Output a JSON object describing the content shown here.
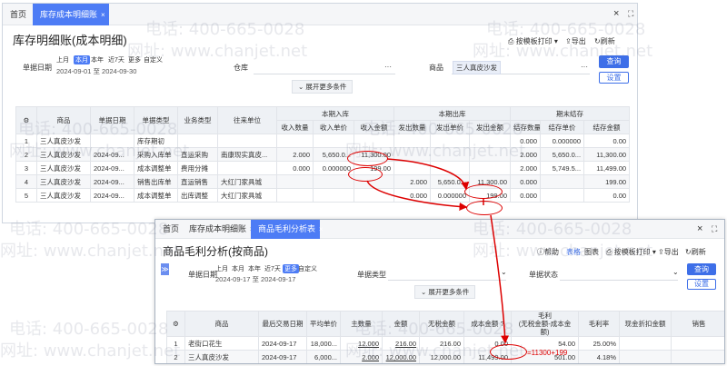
{
  "watermarks": {
    "phone": "电话: 400-665-0028",
    "site": "网址: www.chanjet.net"
  },
  "win1": {
    "tabs": [
      {
        "label": "首页"
      },
      {
        "label": "库存成本明细账",
        "close": "×"
      }
    ],
    "winbtns": {
      "close": "×",
      "max": "⛶"
    },
    "title": "库存明细账(成本明细)",
    "toolbar": {
      "print": "按模板打印",
      "export": "导出",
      "refresh": "刷新"
    },
    "filter": {
      "date_label": "单据日期",
      "chips": [
        "上月",
        "本月",
        "本年",
        "近7天",
        "更多",
        "自定义"
      ],
      "active_chip": "本月",
      "date_range": "2024-09-01 至 2024-09-30",
      "warehouse_label": "仓库",
      "warehouse_more": "···",
      "goods_label": "商品",
      "goods_value": "三人真皮沙发",
      "goods_more": "···",
      "query": "查询",
      "settings": "设置",
      "expand": "展开更多条件"
    },
    "table": {
      "headers_top": [
        "商品",
        "单据日期",
        "单据类型",
        "业务类型",
        "往来单位",
        "本期入库",
        "本期出库",
        "期末结存"
      ],
      "headers_sub": [
        "收入数量",
        "收入单价",
        "收入金额",
        "发出数量",
        "发出单价",
        "发出金额",
        "结存数量",
        "结存单价",
        "结存金额"
      ],
      "rows": [
        [
          "1",
          "三人真皮沙发",
          "",
          "库存期初",
          "",
          "",
          "",
          "",
          "",
          "",
          "",
          "",
          "0.000",
          "0.000000",
          "0.00"
        ],
        [
          "2",
          "三人真皮沙发",
          "2024-09...",
          "采购入库单",
          "直运采购",
          "南康现实真皮...",
          "2.000",
          "5,650.0...",
          "11,300.00",
          "",
          "",
          "",
          "2.000",
          "5,650.0...",
          "11,300.00"
        ],
        [
          "3",
          "三人真皮沙发",
          "2024-09...",
          "成本调整单",
          "费用分摊",
          "",
          "0.000",
          "0.000000",
          "199.00",
          "",
          "",
          "",
          "2.000",
          "5,749.5...",
          "11,499.00"
        ],
        [
          "4",
          "三人真皮沙发",
          "2024-09...",
          "销售出库单",
          "直运销售",
          "大红门家具城",
          "",
          "",
          "",
          "2.000",
          "5,650.0...",
          "11,300.00",
          "0.000",
          "",
          "199.00"
        ],
        [
          "5",
          "三人真皮沙发",
          "2024-09...",
          "成本调整单",
          "出库调整",
          "大红门家具城",
          "",
          "",
          "",
          "0.000",
          "0.000000",
          "199.00",
          "0.000",
          "",
          "0.00"
        ]
      ]
    }
  },
  "win2": {
    "tabs": [
      {
        "label": "首页"
      },
      {
        "label": "库存成本明细账",
        "close": "×"
      },
      {
        "label": "商品毛利分析表",
        "close": "×"
      }
    ],
    "winbtns": {
      "close": "×",
      "max": "⛶"
    },
    "title": "商品毛利分析(按商品)",
    "toolbar": {
      "help": "帮助",
      "table": "表格",
      "chart": "图表",
      "print": "按模板打印",
      "export": "导出",
      "refresh": "刷新"
    },
    "side_toggle": "≫",
    "filter": {
      "date_label": "单据日期",
      "chips": [
        "上月",
        "本月",
        "本年",
        "近7天",
        "更多",
        "自定义"
      ],
      "active_chip": "更多",
      "date_range": "2024-09-17 至 2024-09-17",
      "billtype_label": "单据类型",
      "billstatus_label": "单据状态",
      "query": "查询",
      "settings": "设置",
      "expand": "展开更多条件"
    },
    "table": {
      "headers": [
        "商品",
        "最后交易日期",
        "平均单价",
        "主数量",
        "金额",
        "无税金额",
        "成本金额",
        "毛利\n(无税金额-成本金额)",
        "毛利率",
        "现金折扣金额",
        "销售"
      ],
      "help_icon": "?",
      "rows": [
        [
          "1",
          "老街口花生",
          "2024-09-17",
          "18,000...",
          "12.000",
          "216.00",
          "216.00",
          "0.00",
          "54.00",
          "25.00%",
          ""
        ],
        [
          "2",
          "三人真皮沙发",
          "2024-09-17",
          "6,000...",
          "2.000",
          "12,000.00",
          "12,000.00",
          "11,499.00",
          "501.00",
          "4.18%",
          ""
        ]
      ]
    }
  },
  "annotation": {
    "formula": "=11300+199",
    "color": "#d00000"
  }
}
